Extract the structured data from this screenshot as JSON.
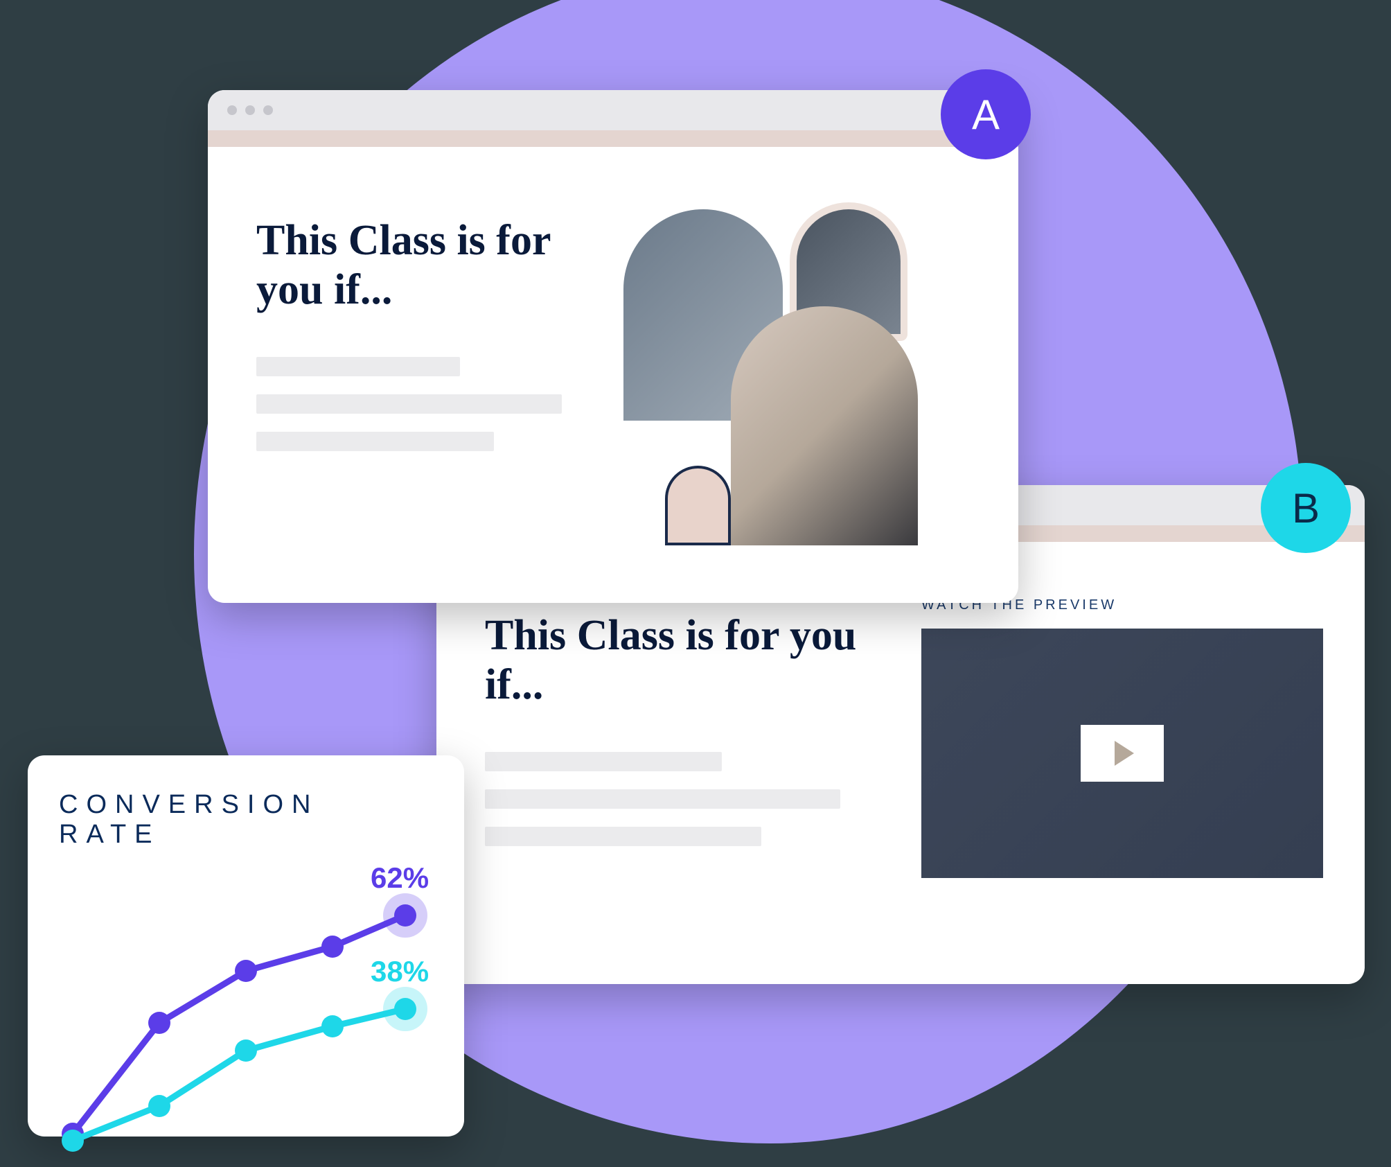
{
  "variant_a": {
    "badge": "A",
    "heading": "This Class is for you if..."
  },
  "variant_b": {
    "badge": "B",
    "heading": "This Class is for you if...",
    "video_label": "WATCH THE PREVIEW"
  },
  "conversion_card": {
    "title": "CONVERSION RATE",
    "label_a": "62%",
    "label_b": "38%"
  },
  "chart_data": {
    "type": "line",
    "title": "CONVERSION RATE",
    "x": [
      1,
      2,
      3,
      4,
      5
    ],
    "series": [
      {
        "name": "A",
        "color": "#5b3de8",
        "values": [
          8,
          35,
          48,
          55,
          62
        ]
      },
      {
        "name": "B",
        "color": "#1ed7e8",
        "values": [
          6,
          14,
          28,
          34,
          38
        ]
      }
    ],
    "ylim": [
      0,
      70
    ],
    "xlabel": "",
    "ylabel": ""
  }
}
